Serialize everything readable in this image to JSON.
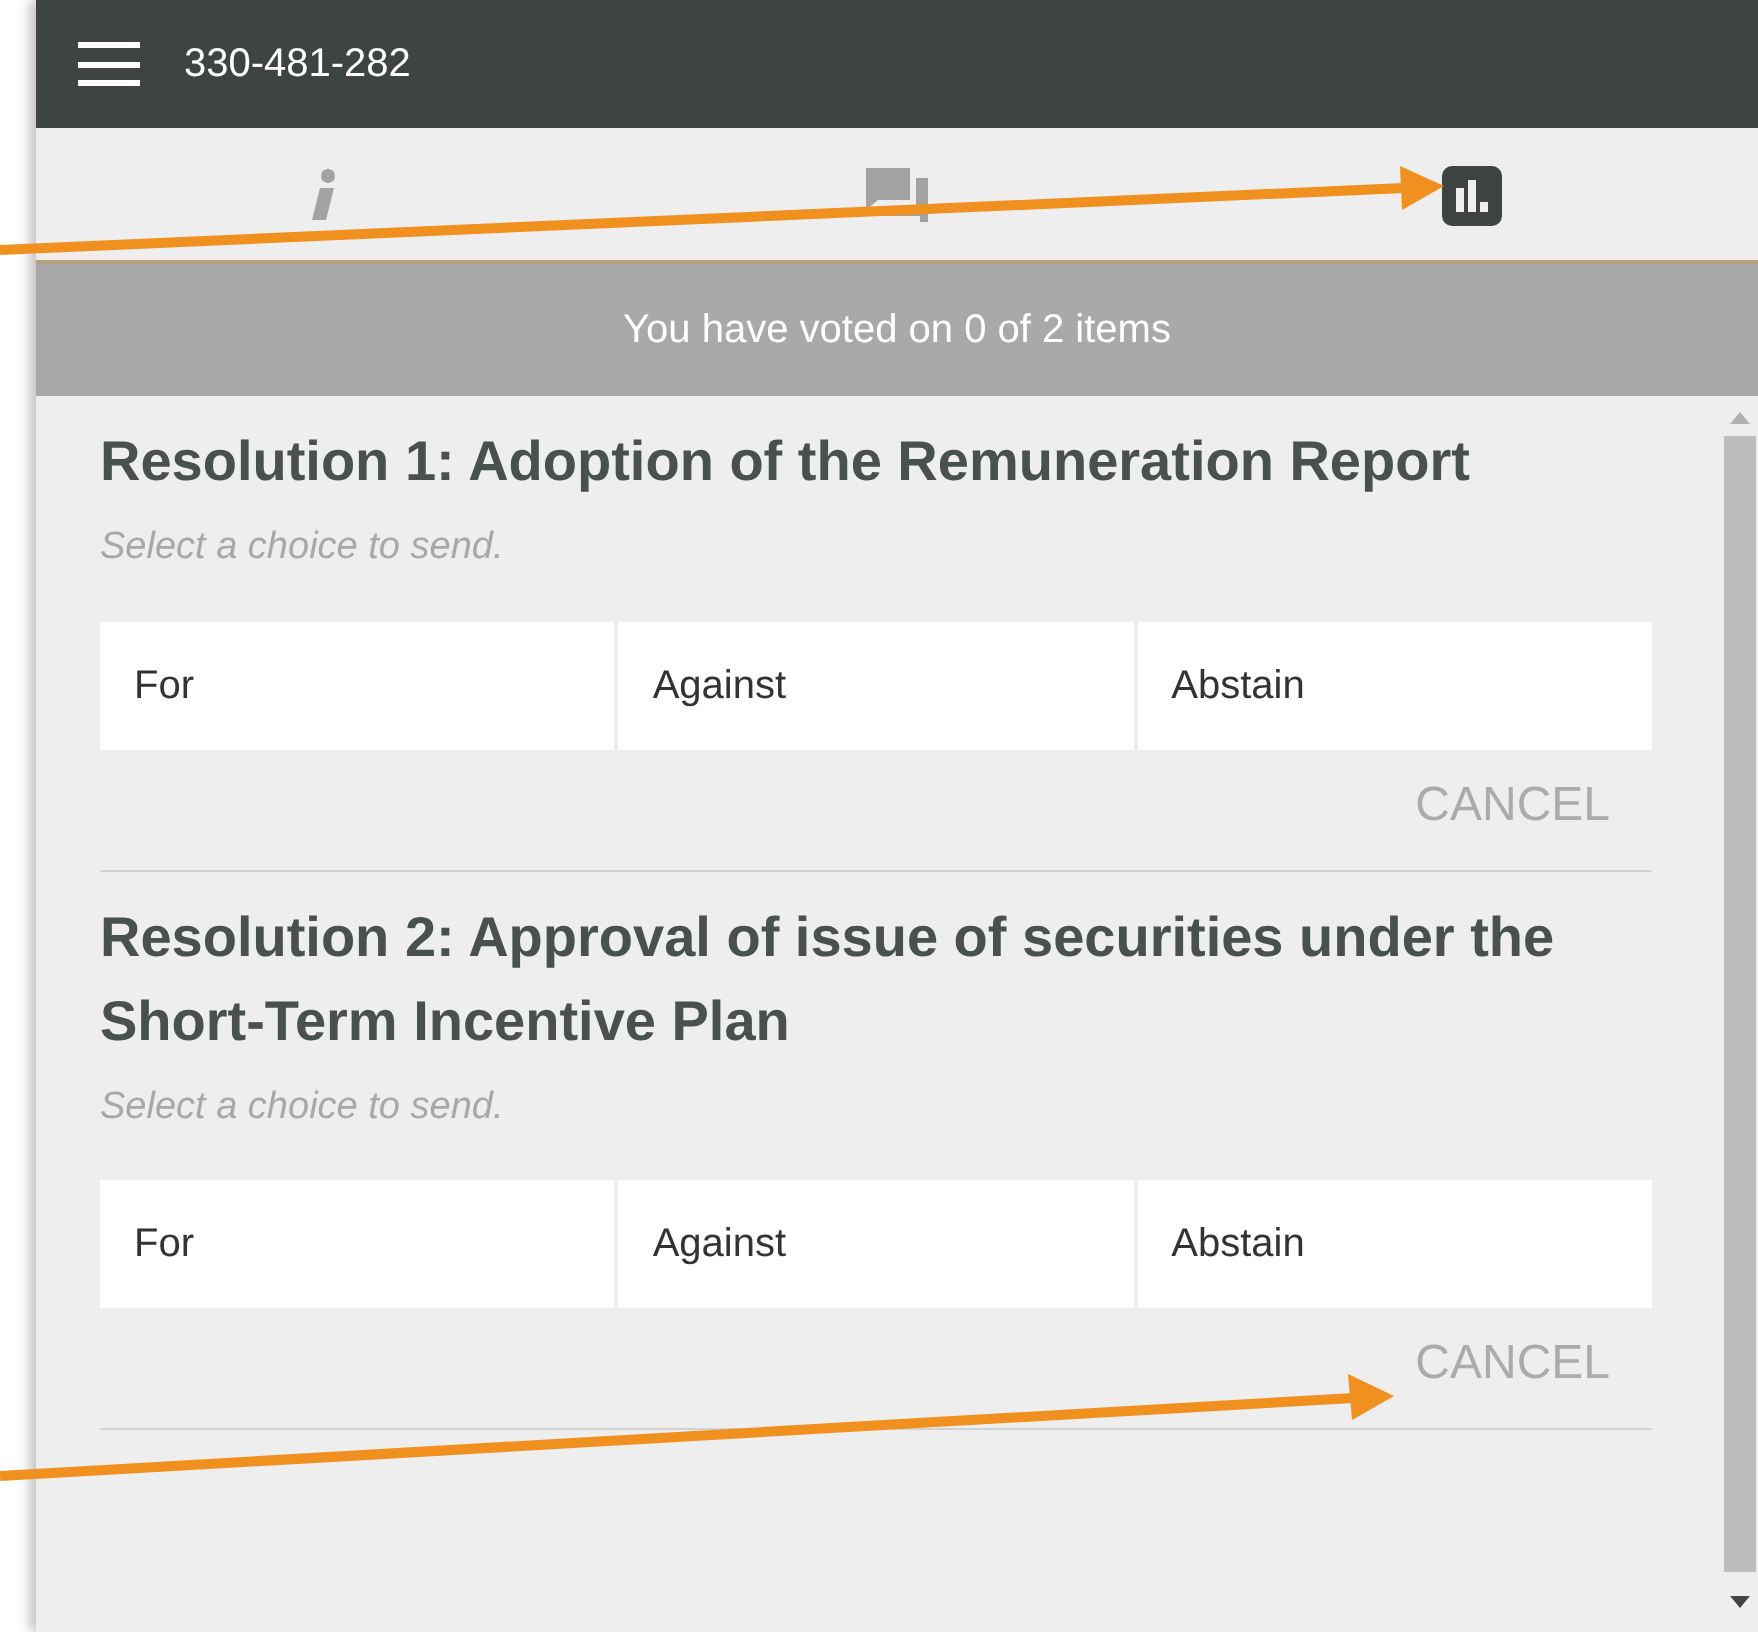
{
  "header": {
    "title": "330-481-282"
  },
  "tabs": [
    {
      "kind": "info",
      "selected": false
    },
    {
      "kind": "chat",
      "selected": false
    },
    {
      "kind": "chart",
      "selected": true
    }
  ],
  "status": "You have voted on 0 of 2 items",
  "resolutions": [
    {
      "title": "Resolution 1: Adoption of the Remuneration Report",
      "hint": "Select a choice to send.",
      "choices": [
        {
          "label": "For",
          "selected": false
        },
        {
          "label": "Against",
          "selected": false
        },
        {
          "label": "Abstain",
          "selected": false
        }
      ],
      "cancel": "CANCEL"
    },
    {
      "title": "Resolution 2: Approval of issue of securities under the Short-Term Incentive Plan",
      "hint": "Select a choice to send.",
      "choices": [
        {
          "label": "For",
          "selected": false
        },
        {
          "label": "Against",
          "selected": false
        },
        {
          "label": "Abstain",
          "selected": false
        }
      ],
      "cancel": "CANCEL"
    }
  ]
}
